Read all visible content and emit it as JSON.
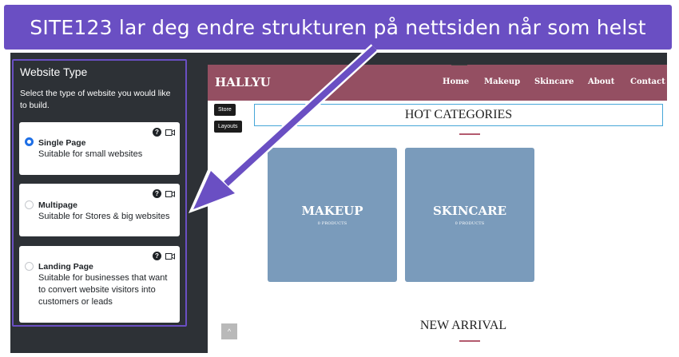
{
  "banner": {
    "text": "SITE123 lar deg endre strukturen på nettsiden når som helst"
  },
  "sidebar": {
    "title": "Website Type",
    "description": "Select the type of website you would like to build.",
    "options": [
      {
        "name": "Single Page",
        "text": "Suitable for small websites",
        "selected": true
      },
      {
        "name": "Multipage",
        "text": "Suitable for Stores & big websites",
        "selected": false
      },
      {
        "name": "Landing Page",
        "text": "Suitable for businesses that want to convert website visitors into customers or leads",
        "selected": false
      }
    ],
    "help_glyph": "?"
  },
  "preview": {
    "brand": "HALLYU",
    "menu": [
      "Home",
      "Makeup",
      "Skincare",
      "About",
      "Contact"
    ],
    "side_buttons": [
      "Store",
      "Layouts"
    ],
    "section_title": "HOT CATEGORIES",
    "categories": [
      {
        "name": "MAKEUP",
        "count": "0 PRODUCTS"
      },
      {
        "name": "SKINCARE",
        "count": "0 PRODUCTS"
      }
    ],
    "next_section": "NEW ARRIVAL",
    "scroll_glyph": "^"
  },
  "colors": {
    "accent": "#6a4fc3",
    "nav": "#944f62",
    "sidebar": "#2d3136",
    "card": "#7a9bbb",
    "radio": "#1e6fe6"
  },
  "icons": [
    "help-icon",
    "video-camera-icon",
    "arrow-icon",
    "chevron-up-icon"
  ]
}
